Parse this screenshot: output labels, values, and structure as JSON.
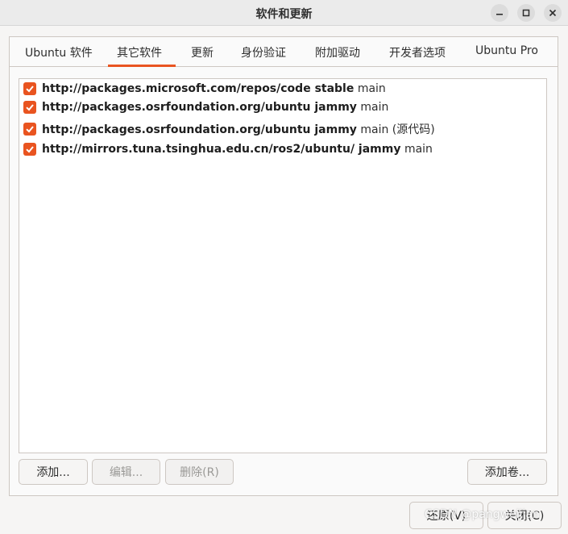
{
  "window": {
    "title": "软件和更新"
  },
  "tabs": [
    {
      "label": "Ubuntu 软件"
    },
    {
      "label": "其它软件",
      "selected": true
    },
    {
      "label": "更新"
    },
    {
      "label": "身份验证"
    },
    {
      "label": "附加驱动"
    },
    {
      "label": "开发者选项"
    },
    {
      "label": "Ubuntu Pro"
    }
  ],
  "sources": [
    {
      "checked": true,
      "url": "http://packages.microsoft.com/repos/code stable",
      "component": "main"
    },
    {
      "checked": true,
      "url": "http://packages.osrfoundation.org/ubuntu jammy",
      "component": "main"
    },
    {
      "checked": true,
      "url": "http://packages.osrfoundation.org/ubuntu jammy",
      "component": "main (源代码)"
    },
    {
      "checked": true,
      "url": "http://mirrors.tuna.tsinghua.edu.cn/ros2/ubuntu/ jammy",
      "component": "main"
    }
  ],
  "buttons": {
    "add": "添加...",
    "edit": "编辑...",
    "remove": "删除(R)",
    "add_volume": "添加卷...",
    "revert": "还原(V)",
    "close": "关闭(C)"
  },
  "watermark": "CSDN @pangweijian",
  "colors": {
    "accent": "#e95420"
  },
  "icons": {
    "minimize": "minimize-icon",
    "maximize": "maximize-icon",
    "close": "close-icon",
    "checkbox": "checkmark-icon"
  }
}
